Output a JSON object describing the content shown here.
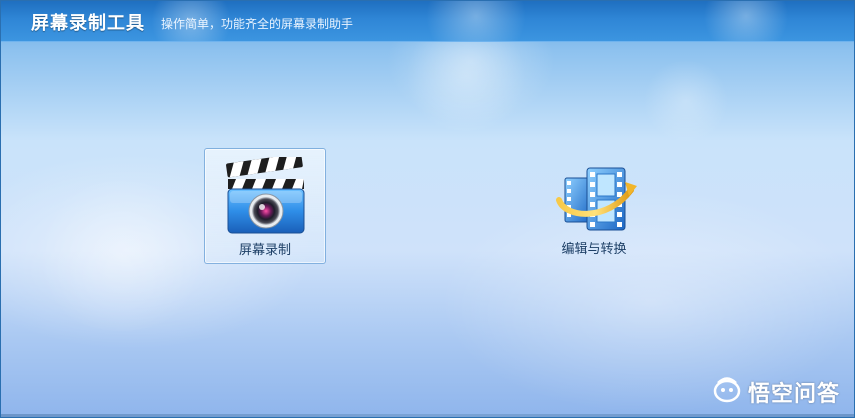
{
  "window": {
    "title": "屏幕录制工具",
    "subtitle": "操作简单，功能齐全的屏幕录制助手"
  },
  "tiles": [
    {
      "label": "屏幕录制",
      "icon": "clapperboard-camera-icon",
      "selected": true
    },
    {
      "label": "编辑与转换",
      "icon": "film-convert-icon",
      "selected": false
    }
  ],
  "watermark": {
    "text": "悟空问答",
    "icon": "wukong-logo-icon"
  },
  "colors": {
    "titlebar": "#2f86d6",
    "label_text": "#1d3f66",
    "accent_blue": "#2a7fd4"
  }
}
